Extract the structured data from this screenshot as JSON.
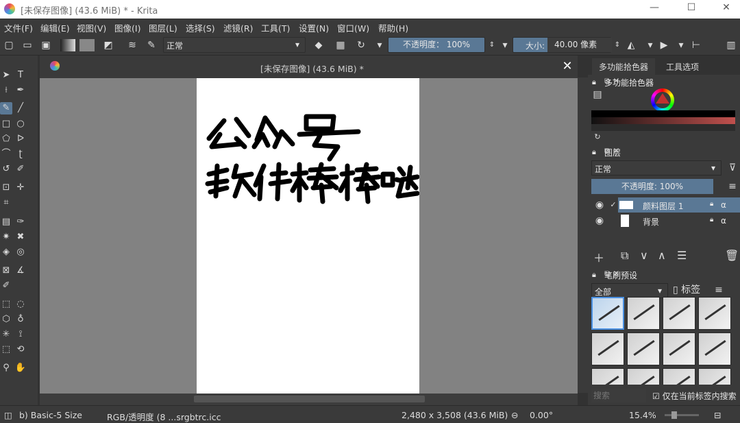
{
  "window": {
    "title": "[未保存图像] (43.6 MiB) * - Krita",
    "controls": [
      "—",
      "☐",
      "✕"
    ]
  },
  "menu": [
    "文件(F)",
    "编辑(E)",
    "视图(V)",
    "图像(I)",
    "图层(L)",
    "选择(S)",
    "滤镜(R)",
    "工具(T)",
    "设置(N)",
    "窗口(W)",
    "帮助(H)"
  ],
  "toolbar": {
    "blend_mode": "正常",
    "opacity": "不透明度： 100%",
    "size_label": "大小:",
    "size_value": "40.00 像素"
  },
  "document": {
    "tab_title": "[未保存图像] (43.6 MiB) *",
    "close": "✕",
    "handwriting": [
      "公众号",
      "软件棒棒哒"
    ]
  },
  "right_panel": {
    "tabs": [
      "多功能拾色器",
      "工具选项"
    ],
    "color_dock_title": "多功能拾色器",
    "layers_dock_title": "图层",
    "layer_blend": "正常",
    "layer_opacity": "不透明度: 100%",
    "layers": [
      {
        "name": "颜料图层 1",
        "selected": true
      },
      {
        "name": "背景",
        "selected": false
      }
    ],
    "brush_dock_title": "笔刷预设",
    "brush_filter": "全部",
    "brush_tag": "标签",
    "brush_search_placeholder": "搜索",
    "brush_check_label": "仅在当前标签内搜索"
  },
  "status": {
    "brush": "b) Basic-5 Size",
    "colorspace": "RGB/透明度 (8 ...srgbtrc.icc",
    "dimensions": "2,480 x 3,508 (43.6 MiB)",
    "rotation": "0.00°",
    "zoom": "15.4%"
  },
  "colors": {
    "accent": "#5a7895",
    "panel": "#3a3a3a",
    "canvas_bg": "#828282"
  }
}
